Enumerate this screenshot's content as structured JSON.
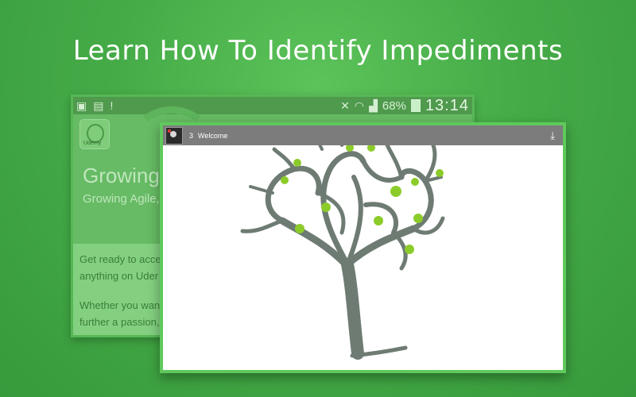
{
  "headline": "Learn How To Identify Impediments",
  "back_screen": {
    "status": {
      "battery_percent": "68%",
      "time": "13:14"
    },
    "title": "Growing",
    "subtitle": "Growing Agile,",
    "body_lines": [
      "Get ready to acce",
      "anything on Uder",
      "Whether you wan",
      "further a passion,"
    ],
    "icons": [
      "image-icon",
      "sim-icon",
      "alert-icon",
      "mute-icon",
      "wifi-icon",
      "signal-icon",
      "battery-icon"
    ]
  },
  "front_screen": {
    "lecture_number": "3",
    "lecture_title": "Welcome",
    "accent_color": "#5fc95c",
    "tree_color": "#6e7b73",
    "leaf_color": "#8ccc2a"
  }
}
